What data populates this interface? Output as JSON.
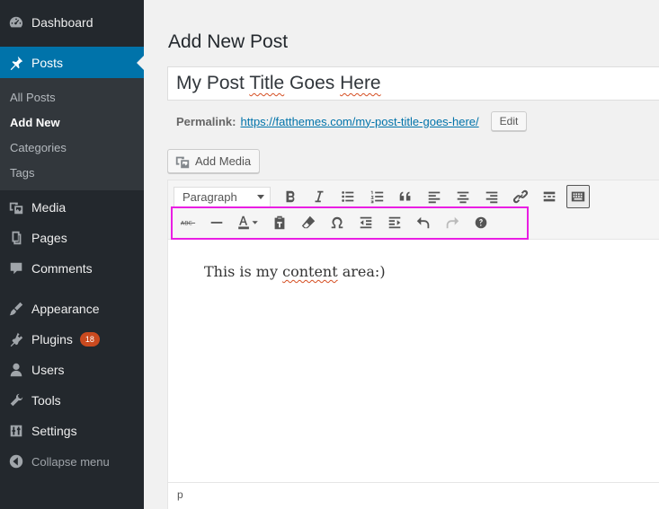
{
  "sidebar": {
    "dashboard": "Dashboard",
    "posts": "Posts",
    "submenu": [
      "All Posts",
      "Add New",
      "Categories",
      "Tags"
    ],
    "media": "Media",
    "pages": "Pages",
    "comments": "Comments",
    "appearance": "Appearance",
    "plugins": "Plugins",
    "plugins_badge": "18",
    "users": "Users",
    "tools": "Tools",
    "settings": "Settings",
    "collapse": "Collapse menu"
  },
  "main": {
    "page_title": "Add New Post",
    "title_words": [
      "My Post ",
      "Title",
      " Goes ",
      "Here"
    ],
    "permalink_label": "Permalink:",
    "permalink_url": "https://fatthemes.com/my-post-title-goes-here/",
    "edit_label": "Edit",
    "add_media_label": "Add Media"
  },
  "editor": {
    "format_selected": "Paragraph",
    "row1_icons": [
      "bold-icon",
      "italic-icon",
      "bulleted-list-icon",
      "numbered-list-icon",
      "blockquote-icon",
      "align-left-icon",
      "align-center-icon",
      "align-right-icon",
      "link-icon",
      "read-more-icon",
      "toolbar-toggle-icon"
    ],
    "row2_icons": [
      "strikethrough-icon",
      "horizontal-line-icon",
      "text-color-icon",
      "paste-as-text-icon",
      "clear-formatting-icon",
      "special-character-icon",
      "outdent-icon",
      "indent-icon",
      "undo-icon",
      "redo-icon",
      "help-icon"
    ],
    "content_parts": [
      "This is my ",
      "content",
      " area:)"
    ],
    "status_path": "p"
  },
  "colors": {
    "sidebar_bg": "#23282d",
    "active": "#0073aa",
    "highlight": "#e91ee3",
    "badge": "#ca4a1f"
  }
}
